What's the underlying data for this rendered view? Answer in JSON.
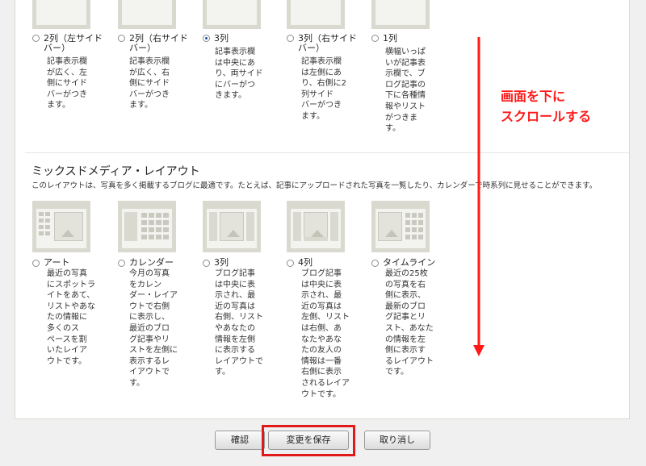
{
  "top_options": [
    {
      "label": "2列（左サイドバー）",
      "label_lines": [
        "2列（左サイド",
        "バー）"
      ],
      "desc_lines": [
        "記事表示欄",
        "が広く、左",
        "側にサイド",
        "バーがつき",
        "ます。"
      ],
      "selected": false
    },
    {
      "label": "2列（右サイドバー）",
      "label_lines": [
        "2列（右サイド",
        "バー）"
      ],
      "desc_lines": [
        "記事表示欄",
        "が広く、右",
        "側にサイド",
        "バーがつき",
        "ます。"
      ],
      "selected": false
    },
    {
      "label": "3列",
      "label_lines": [
        "3列"
      ],
      "desc_lines": [
        "記事表示欄",
        "は中央にあ",
        "り、両サイド",
        "にバーがつ",
        "きます。"
      ],
      "selected": true
    },
    {
      "label": "3列（右サイドバー）",
      "label_lines": [
        "3列（右サイド",
        "バー）"
      ],
      "desc_lines": [
        "記事表示欄",
        "は左側にあ",
        "り、右側に2",
        "列サイド",
        "バーがつき",
        "ます。"
      ],
      "selected": false
    },
    {
      "label": "1列",
      "label_lines": [
        "1列"
      ],
      "desc_lines": [
        "横幅いっぱ",
        "いが記事表",
        "示欄で、ブ",
        "ログ記事の",
        "下に各種情",
        "報やリスト",
        "がつきま",
        "す。"
      ],
      "selected": false
    }
  ],
  "mixed_media": {
    "title": "ミックスドメディア・レイアウト",
    "description": "このレイアウトは、写真を多く掲載するブログに最適です。たとえば、記事にアップロードされた写真を一覧したり、カレンダーで時系列に見せることができます。",
    "options": [
      {
        "label": "アート",
        "desc_lines": [
          "最近の写真",
          "にスポットラ",
          "イトをあて、",
          "リストやあな",
          "たの情報に",
          "多くのス",
          "ペースを割",
          "いたレイア",
          "ウトです。"
        ],
        "selected": false
      },
      {
        "label": "カレンダー",
        "desc_lines": [
          "今月の写真",
          "をカレン",
          "ダー・レイア",
          "ウトで右側",
          "に表示し、",
          "最近のブロ",
          "グ記事やリ",
          "ストを左側に",
          "表示するレ",
          "イアウトで",
          "す。"
        ],
        "selected": false
      },
      {
        "label": "3列",
        "desc_lines": [
          "ブログ記事",
          "は中央に表",
          "示され、最",
          "近の写真は",
          "右側、リスト",
          "やあなたの",
          "情報を左側",
          "に表示する",
          "レイアウトで",
          "す。"
        ],
        "selected": false
      },
      {
        "label": "4列",
        "desc_lines": [
          "ブログ記事",
          "は中央に表",
          "示され、最",
          "近の写真は",
          "左側、リスト",
          "は右側、あ",
          "なたやあな",
          "たの友人の",
          "情報は一番",
          "右側に表示",
          "されるレイア",
          "ウトです。"
        ],
        "selected": false
      },
      {
        "label": "タイムライン",
        "desc_lines": [
          "最近の25枚",
          "の写真を右",
          "側に表示、",
          "最新のブロ",
          "グ記事とリ",
          "スト、あなた",
          "の情報を左",
          "側に表示す",
          "るレイアウト",
          "です。"
        ],
        "selected": false
      }
    ]
  },
  "annotation": {
    "line1": "画面を下に",
    "line2": "スクロールする",
    "color": "#ff1a1a"
  },
  "buttons": {
    "confirm": "確認",
    "save": "変更を保存",
    "cancel": "取り消し"
  },
  "colors": {
    "highlight": "#e01a1a",
    "thumb": "#d9d9cf"
  }
}
